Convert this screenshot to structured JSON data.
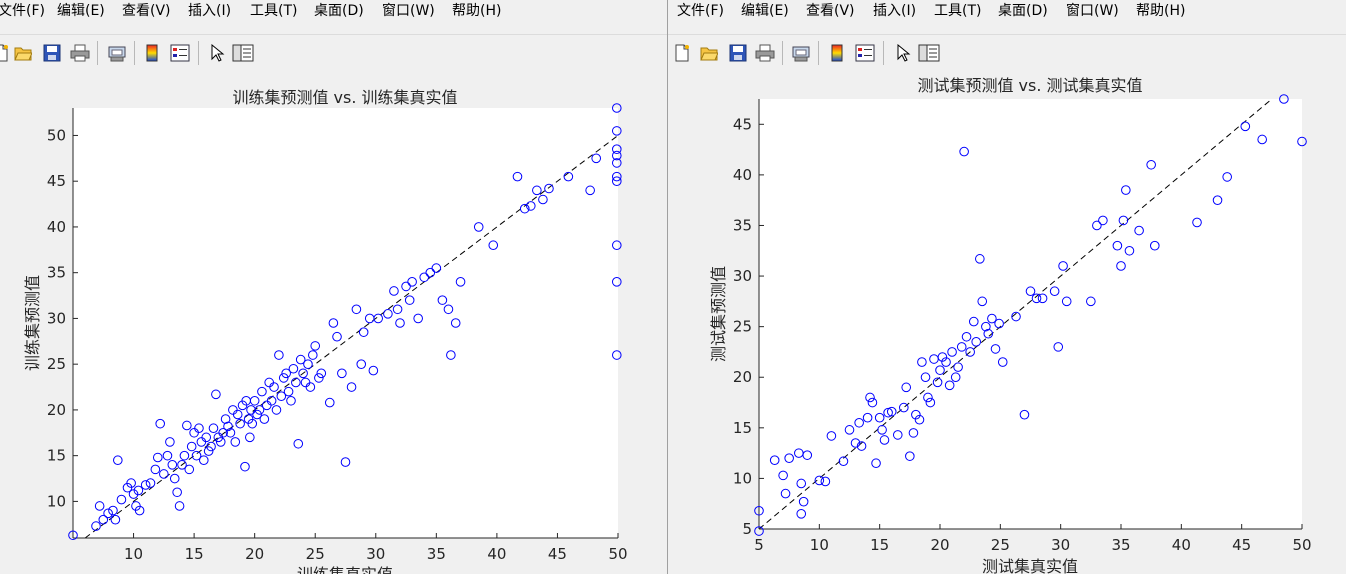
{
  "menu": [
    "文件(F)",
    "编辑(E)",
    "查看(V)",
    "插入(I)",
    "工具(T)",
    "桌面(D)",
    "窗口(W)",
    "帮助(H)"
  ],
  "toolbar_icons": [
    "new-file-icon",
    "open-folder-icon",
    "save-icon",
    "print-icon",
    "print-preview-icon",
    "colorbar-icon",
    "legend-icon",
    "pointer-icon",
    "property-inspector-icon"
  ],
  "colors": {
    "marker": "#0000ff",
    "axes": "#262626",
    "figure_bg": "#f0f0f0",
    "plot_bg": "#ffffff"
  },
  "chart_data": [
    {
      "type": "scatter",
      "title": "训练集预测值 vs. 训练集真实值",
      "xlabel": "训练集真实值",
      "ylabel": "训练集预测值",
      "xlim": [
        5,
        50
      ],
      "ylim": [
        6,
        53
      ],
      "xticks": [
        10,
        15,
        20,
        25,
        30,
        35,
        40,
        45,
        50
      ],
      "yticks": [
        10,
        15,
        20,
        25,
        30,
        35,
        40,
        45,
        50
      ],
      "reference_line": "y = x (dashed black)",
      "marker": "open circle, blue",
      "points": [
        [
          5,
          6.3
        ],
        [
          6.9,
          7.3
        ],
        [
          7.2,
          9.5
        ],
        [
          7.5,
          8
        ],
        [
          7.9,
          8.7
        ],
        [
          8.3,
          9
        ],
        [
          8.5,
          8
        ],
        [
          8.7,
          14.5
        ],
        [
          9,
          10.2
        ],
        [
          9.5,
          11.5
        ],
        [
          9.8,
          12
        ],
        [
          10,
          10.8
        ],
        [
          10.2,
          9.5
        ],
        [
          10.4,
          11.2
        ],
        [
          10.5,
          9
        ],
        [
          11,
          11.8
        ],
        [
          11.4,
          12
        ],
        [
          11.8,
          13.5
        ],
        [
          12,
          14.8
        ],
        [
          12.2,
          18.5
        ],
        [
          12.5,
          13
        ],
        [
          12.8,
          15
        ],
        [
          13,
          16.5
        ],
        [
          13.2,
          14
        ],
        [
          13.4,
          12.5
        ],
        [
          13.6,
          11
        ],
        [
          13.8,
          9.5
        ],
        [
          14,
          14
        ],
        [
          14.2,
          15
        ],
        [
          14.4,
          18.3
        ],
        [
          14.6,
          13.5
        ],
        [
          14.8,
          16
        ],
        [
          15,
          17.5
        ],
        [
          15.2,
          15
        ],
        [
          15.4,
          18
        ],
        [
          15.6,
          16.5
        ],
        [
          15.8,
          14.5
        ],
        [
          16,
          17
        ],
        [
          16.2,
          15.5
        ],
        [
          16.4,
          16
        ],
        [
          16.6,
          18
        ],
        [
          16.8,
          21.7
        ],
        [
          17,
          17
        ],
        [
          17.2,
          16.5
        ],
        [
          17.4,
          17.5
        ],
        [
          17.6,
          19
        ],
        [
          17.8,
          18.2
        ],
        [
          18,
          17.5
        ],
        [
          18.2,
          20
        ],
        [
          18.4,
          16.5
        ],
        [
          18.6,
          19.5
        ],
        [
          18.8,
          18.5
        ],
        [
          19,
          20.5
        ],
        [
          19.2,
          13.8
        ],
        [
          19.3,
          21
        ],
        [
          19.5,
          19
        ],
        [
          19.6,
          17
        ],
        [
          19.7,
          20
        ],
        [
          19.8,
          18.5
        ],
        [
          20,
          21
        ],
        [
          20.2,
          19.5
        ],
        [
          20.4,
          20
        ],
        [
          20.6,
          22
        ],
        [
          20.8,
          19
        ],
        [
          21,
          20.5
        ],
        [
          21.2,
          23
        ],
        [
          21.4,
          21
        ],
        [
          21.6,
          22.5
        ],
        [
          21.8,
          20
        ],
        [
          22,
          26
        ],
        [
          22.2,
          21.5
        ],
        [
          22.4,
          23.5
        ],
        [
          22.6,
          24
        ],
        [
          22.8,
          22
        ],
        [
          23,
          21
        ],
        [
          23.2,
          24.5
        ],
        [
          23.4,
          23
        ],
        [
          23.6,
          16.3
        ],
        [
          23.8,
          25.5
        ],
        [
          24,
          24
        ],
        [
          24.2,
          23
        ],
        [
          24.4,
          25
        ],
        [
          24.6,
          22.5
        ],
        [
          24.8,
          26
        ],
        [
          25,
          27
        ],
        [
          25.3,
          23.5
        ],
        [
          25.5,
          24
        ],
        [
          26.2,
          20.8
        ],
        [
          26.5,
          29.5
        ],
        [
          26.8,
          28
        ],
        [
          27.2,
          24
        ],
        [
          27.5,
          14.3
        ],
        [
          28,
          22.5
        ],
        [
          28.4,
          31
        ],
        [
          28.8,
          25
        ],
        [
          29,
          28.5
        ],
        [
          29.5,
          30
        ],
        [
          29.8,
          24.3
        ],
        [
          30.2,
          30
        ],
        [
          31,
          30.5
        ],
        [
          31.5,
          33
        ],
        [
          31.8,
          31
        ],
        [
          32,
          29.5
        ],
        [
          32.5,
          33.5
        ],
        [
          32.8,
          32
        ],
        [
          33,
          34
        ],
        [
          33.5,
          30
        ],
        [
          34,
          34.5
        ],
        [
          34.5,
          35
        ],
        [
          35,
          35.5
        ],
        [
          35.5,
          32
        ],
        [
          36,
          31
        ],
        [
          36.2,
          26
        ],
        [
          36.6,
          29.5
        ],
        [
          37,
          34
        ],
        [
          38.5,
          40
        ],
        [
          39.7,
          38
        ],
        [
          41.7,
          45.5
        ],
        [
          42.3,
          42
        ],
        [
          42.8,
          42.3
        ],
        [
          43.3,
          44
        ],
        [
          43.8,
          43
        ],
        [
          44.3,
          44.2
        ],
        [
          45.9,
          45.5
        ],
        [
          47.7,
          44
        ],
        [
          48.2,
          47.5
        ],
        [
          49.9,
          53
        ],
        [
          49.9,
          50.5
        ],
        [
          49.9,
          48.5
        ],
        [
          49.9,
          47.8
        ],
        [
          49.9,
          47
        ],
        [
          49.9,
          45.5
        ],
        [
          49.9,
          45
        ],
        [
          49.9,
          38
        ],
        [
          49.9,
          34
        ],
        [
          49.9,
          26
        ]
      ]
    },
    {
      "type": "scatter",
      "title": "测试集预测值 vs. 测试集真实值",
      "xlabel": "测试集真实值",
      "ylabel": "测试集预测值",
      "xlim": [
        5,
        50
      ],
      "ylim": [
        5,
        47.5
      ],
      "xticks": [
        5,
        10,
        15,
        20,
        25,
        30,
        35,
        40,
        45,
        50
      ],
      "yticks": [
        5,
        10,
        15,
        20,
        25,
        30,
        35,
        40,
        45
      ],
      "reference_line": "y = x (dashed black)",
      "marker": "open circle, blue",
      "points": [
        [
          5,
          4.8
        ],
        [
          5,
          6.8
        ],
        [
          6.3,
          11.8
        ],
        [
          7,
          10.3
        ],
        [
          7.2,
          8.5
        ],
        [
          7.5,
          12
        ],
        [
          8.3,
          12.5
        ],
        [
          8.5,
          9.5
        ],
        [
          8.5,
          6.5
        ],
        [
          8.7,
          7.7
        ],
        [
          9,
          12.3
        ],
        [
          10,
          9.8
        ],
        [
          10.5,
          9.7
        ],
        [
          11,
          14.2
        ],
        [
          12,
          11.7
        ],
        [
          12.5,
          14.8
        ],
        [
          13,
          13.5
        ],
        [
          13.3,
          15.5
        ],
        [
          13.5,
          13.2
        ],
        [
          14,
          16
        ],
        [
          14.2,
          18
        ],
        [
          14.4,
          17.5
        ],
        [
          14.7,
          11.5
        ],
        [
          15,
          16
        ],
        [
          15.2,
          14.8
        ],
        [
          15.4,
          13.8
        ],
        [
          15.7,
          16.5
        ],
        [
          16,
          16.6
        ],
        [
          16.5,
          14.3
        ],
        [
          17,
          17
        ],
        [
          17.2,
          19
        ],
        [
          17.5,
          12.2
        ],
        [
          17.8,
          14.5
        ],
        [
          18,
          16.3
        ],
        [
          18.3,
          15.8
        ],
        [
          18.5,
          21.5
        ],
        [
          18.8,
          20
        ],
        [
          19,
          18
        ],
        [
          19.2,
          17.5
        ],
        [
          19.5,
          21.8
        ],
        [
          19.8,
          19.5
        ],
        [
          20,
          20.7
        ],
        [
          20.2,
          22
        ],
        [
          20.5,
          21.5
        ],
        [
          20.8,
          19.2
        ],
        [
          21,
          22.5
        ],
        [
          21.3,
          20
        ],
        [
          21.5,
          21
        ],
        [
          21.8,
          23
        ],
        [
          22,
          42.3
        ],
        [
          22.2,
          24
        ],
        [
          22.5,
          22.5
        ],
        [
          22.8,
          25.5
        ],
        [
          23,
          23.5
        ],
        [
          23.3,
          31.7
        ],
        [
          23.5,
          27.5
        ],
        [
          23.8,
          25
        ],
        [
          24,
          24.3
        ],
        [
          24.3,
          25.8
        ],
        [
          24.6,
          22.8
        ],
        [
          24.9,
          25.3
        ],
        [
          25.2,
          21.5
        ],
        [
          26.3,
          26
        ],
        [
          27,
          16.3
        ],
        [
          27.5,
          28.5
        ],
        [
          28,
          27.8
        ],
        [
          28.5,
          27.8
        ],
        [
          29.5,
          28.5
        ],
        [
          29.8,
          23
        ],
        [
          30.2,
          31
        ],
        [
          30.5,
          27.5
        ],
        [
          32.5,
          27.5
        ],
        [
          33,
          35
        ],
        [
          33.5,
          35.5
        ],
        [
          34.7,
          33
        ],
        [
          35,
          31
        ],
        [
          35.2,
          35.5
        ],
        [
          35.4,
          38.5
        ],
        [
          35.7,
          32.5
        ],
        [
          36.5,
          34.5
        ],
        [
          37.5,
          41
        ],
        [
          37.8,
          33
        ],
        [
          41.3,
          35.3
        ],
        [
          43,
          37.5
        ],
        [
          43.8,
          39.8
        ],
        [
          45.3,
          44.8
        ],
        [
          46.7,
          43.5
        ],
        [
          48.5,
          47.5
        ],
        [
          50,
          43.3
        ]
      ]
    }
  ]
}
